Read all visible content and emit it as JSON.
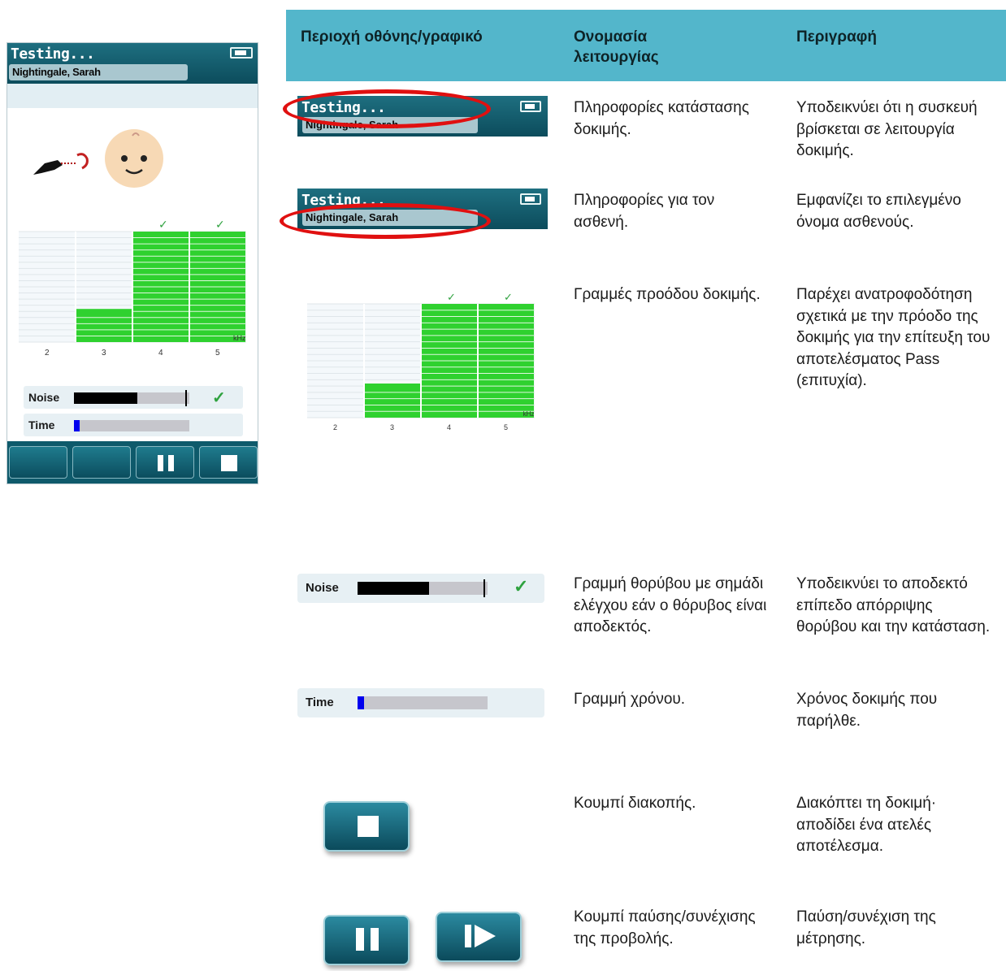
{
  "device": {
    "title": "Testing...",
    "patient": "Nightingale, Sarah",
    "noise_label": "Noise",
    "time_label": "Time",
    "noise_level": 0.55,
    "noise_limit": 0.98,
    "time_progress": 0.05
  },
  "chart_data": {
    "type": "bar",
    "categories": [
      "2",
      "3",
      "4",
      "5"
    ],
    "values": [
      0,
      0.3,
      1.0,
      1.0
    ],
    "passed": [
      false,
      false,
      true,
      true
    ],
    "xlabel": "kHz",
    "ylim": [
      0,
      1
    ]
  },
  "table": {
    "headers": [
      "Περιοχή οθόνης/γραφικό",
      "Ονομασία λειτουργίας",
      "Περιγραφή"
    ],
    "rows": [
      {
        "name": "Πληροφορίες κατάστασης δοκιμής.",
        "desc": "Υποδεικνύει ότι η συσκευή βρίσκεται σε λειτουργία δοκιμής."
      },
      {
        "name": "Πληροφορίες για τον ασθενή.",
        "desc": "Εμφανίζει το επιλεγμένο όνομα ασθενούς."
      },
      {
        "name": "Γραμμές προόδου δοκιμής.",
        "desc": "Παρέχει ανατροφοδότηση σχετικά με την πρόοδο της δοκιμής για την επίτευξη του αποτελέσματος Pass (επιτυχία)."
      },
      {
        "name": "Γραμμή θορύβου με σημάδι ελέγχου εάν ο θόρυβος είναι αποδεκτός.",
        "desc": "Υποδεικνύει το αποδεκτό επίπεδο απόρριψης θορύβου και την κατάσταση."
      },
      {
        "name": "Γραμμή χρόνου.",
        "desc": "Χρόνος δοκιμής που παρήλθε."
      },
      {
        "name": "Κουμπί διακοπής.",
        "desc": "Διακόπτει τη δοκιμή· αποδίδει ένα ατελές αποτέλεσμα."
      },
      {
        "name": "Κουμπί παύσης/συνέχισης της προβολής.",
        "desc": "Παύση/συνέχιση της μέτρησης."
      }
    ]
  },
  "colors": {
    "header_teal": "#0c4c5c",
    "table_header": "#53b6cb",
    "bar_green": "#2fd12f",
    "check_green": "#2fa23f",
    "highlight_red": "#e01010",
    "time_blue": "#0000ee"
  }
}
